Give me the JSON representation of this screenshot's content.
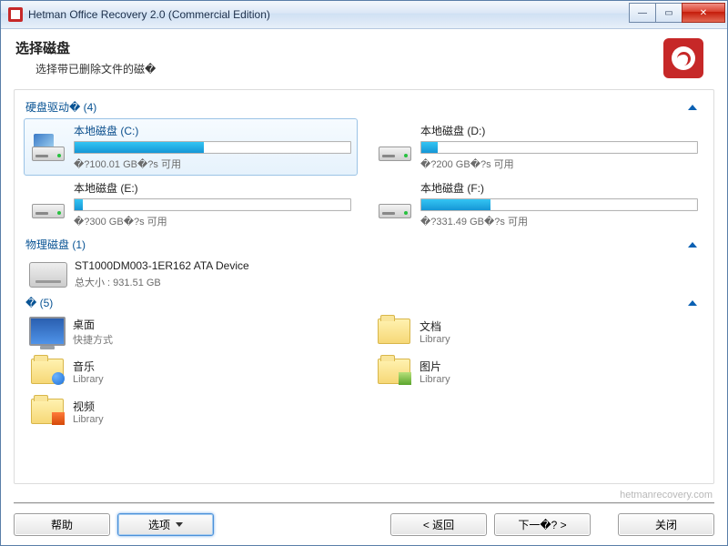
{
  "window": {
    "title": "Hetman Office Recovery 2.0 (Commercial Edition)"
  },
  "header": {
    "title": "选择磁盘",
    "subtitle": "选择带已删除文件的磁�"
  },
  "sections": {
    "drives_label": "硬盘驱动� (4)",
    "physical_label": "物理磁盘 (1)",
    "locations_label": "� (5)"
  },
  "drives": [
    {
      "name": "本地磁盘 (C:)",
      "free": "�?100.01 GB�?s 可用",
      "fill_pct": 47,
      "os": true,
      "selected": true
    },
    {
      "name": "本地磁盘 (D:)",
      "free": "�?200 GB�?s 可用",
      "fill_pct": 6,
      "os": false,
      "selected": false
    },
    {
      "name": "本地磁盘 (E:)",
      "free": "�?300 GB�?s 可用",
      "fill_pct": 3,
      "os": false,
      "selected": false
    },
    {
      "name": "本地磁盘 (F:)",
      "free": "�?331.49 GB�?s 可用",
      "fill_pct": 25,
      "os": false,
      "selected": false
    }
  ],
  "physical": {
    "name": "ST1000DM003-1ER162 ATA Device",
    "size": "总大小 : 931.51 GB"
  },
  "locations": [
    {
      "name": "桌面",
      "sub": "快捷方式",
      "kind": "desktop"
    },
    {
      "name": "文档",
      "sub": "Library",
      "kind": "folder"
    },
    {
      "name": "音乐",
      "sub": "Library",
      "kind": "music"
    },
    {
      "name": "图片",
      "sub": "Library",
      "kind": "pic"
    },
    {
      "name": "视频",
      "sub": "Library",
      "kind": "vid"
    }
  ],
  "footer": {
    "brand": "hetmanrecovery.com",
    "help": "帮助",
    "options": "选项",
    "back": "< 返回",
    "next": "下一�? >",
    "close": "关闭"
  }
}
